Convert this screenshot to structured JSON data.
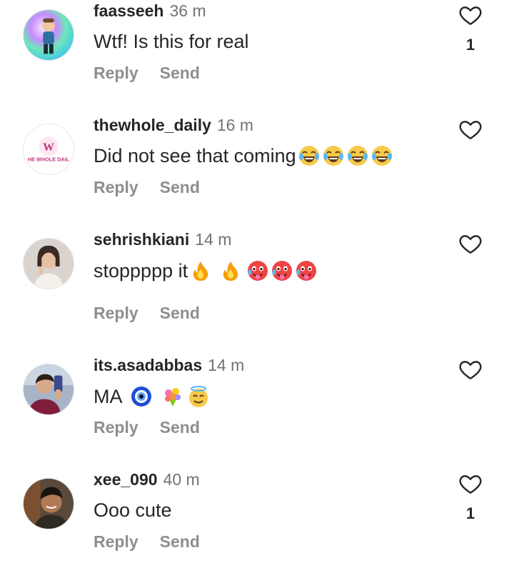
{
  "comments": [
    {
      "username": "faasseeh",
      "time": "36 m",
      "text": "Wtf! Is this for real",
      "emojis": [],
      "reply_label": "Reply",
      "send_label": "Send",
      "like_count": "1"
    },
    {
      "username": "thewhole_daily",
      "time": "16 m",
      "text": "Did not see that coming",
      "emojis": [
        "face-with-tears-of-joy",
        "face-with-tears-of-joy",
        "face-with-tears-of-joy",
        "face-with-tears-of-joy"
      ],
      "reply_label": "Reply",
      "send_label": "Send",
      "like_count": "",
      "avatar_logo_letter": "W",
      "avatar_logo_text": "HE WHOLE DAIL"
    },
    {
      "username": "sehrishkiani",
      "time": "14 m",
      "text": "stoppppp it",
      "emojis": [
        "fire",
        "fire",
        "hot-face",
        "hot-face",
        "hot-face"
      ],
      "reply_label": "Reply",
      "send_label": "Send",
      "like_count": ""
    },
    {
      "username": "its.asadabbas",
      "time": "14 m",
      "text": "MA",
      "emojis": [
        "nazar-amulet",
        "bouquet",
        "smiling-face-with-halo"
      ],
      "reply_label": "Reply",
      "send_label": "Send",
      "like_count": ""
    },
    {
      "username": "xee_090",
      "time": "40 m",
      "text": "Ooo cute",
      "emojis": [],
      "reply_label": "Reply",
      "send_label": "Send",
      "like_count": "1"
    }
  ],
  "colors": {
    "text": "#262626",
    "muted": "#737373",
    "action": "#8e8e8e",
    "brand_pink": "#c13584"
  }
}
